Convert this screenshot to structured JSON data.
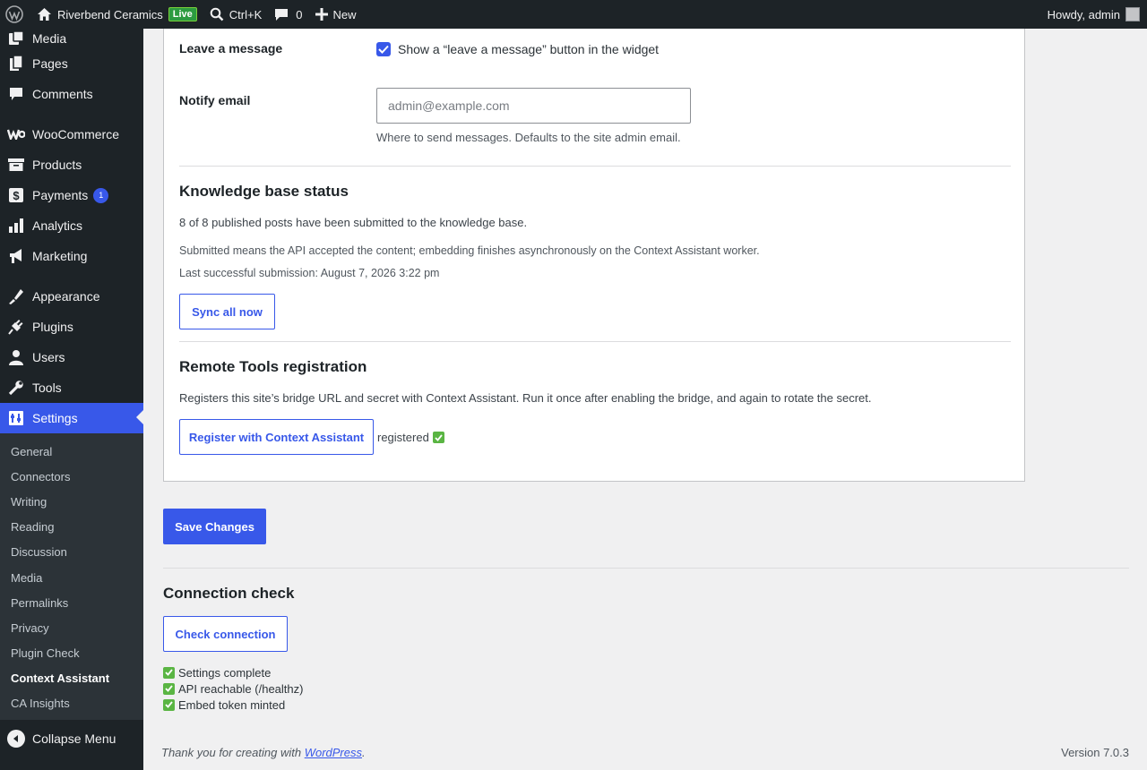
{
  "adminbar": {
    "site_name": "Riverbend Ceramics",
    "live_badge": "Live",
    "search_shortcut": "Ctrl+K",
    "comments_count": "0",
    "new_label": "New",
    "greeting": "Howdy, admin"
  },
  "sidebar": {
    "items": [
      {
        "label": "Media",
        "icon": "media-icon"
      },
      {
        "label": "Pages",
        "icon": "pages-icon"
      },
      {
        "label": "Comments",
        "icon": "comments-icon"
      },
      {
        "label": "WooCommerce",
        "icon": "woocommerce-icon"
      },
      {
        "label": "Products",
        "icon": "products-icon"
      },
      {
        "label": "Payments",
        "icon": "payments-icon",
        "badge": "1"
      },
      {
        "label": "Analytics",
        "icon": "analytics-icon"
      },
      {
        "label": "Marketing",
        "icon": "marketing-icon"
      },
      {
        "label": "Appearance",
        "icon": "appearance-icon"
      },
      {
        "label": "Plugins",
        "icon": "plugins-icon"
      },
      {
        "label": "Users",
        "icon": "users-icon"
      },
      {
        "label": "Tools",
        "icon": "tools-icon"
      },
      {
        "label": "Settings",
        "icon": "settings-icon"
      }
    ],
    "submenu": [
      "General",
      "Connectors",
      "Writing",
      "Reading",
      "Discussion",
      "Media",
      "Permalinks",
      "Privacy",
      "Plugin Check",
      "Context Assistant",
      "CA Insights"
    ],
    "collapse_label": "Collapse Menu"
  },
  "form": {
    "leave_message_label": "Leave a message",
    "leave_message_checkbox": "Show a “leave a message” button in the widget",
    "leave_message_checked": true,
    "notify_email_label": "Notify email",
    "notify_email_placeholder": "admin@example.com",
    "notify_email_value": "",
    "notify_email_help": "Where to send messages. Defaults to the site admin email."
  },
  "kb": {
    "title": "Knowledge base status",
    "summary": "8 of 8 published posts have been submitted to the knowledge base.",
    "note": "Submitted means the API accepted the content; embedding finishes asynchronously on the Context Assistant worker.",
    "last_submission": "Last successful submission: August 7, 2026 3:22 pm",
    "sync_button": "Sync all now"
  },
  "remote": {
    "title": "Remote Tools registration",
    "description": "Registers this site’s bridge URL and secret with Context Assistant. Run it once after enabling the bridge, and again to rotate the secret.",
    "register_button": "Register with Context Assistant",
    "status": "registered"
  },
  "save_button": "Save Changes",
  "connection": {
    "title": "Connection check",
    "button": "Check connection",
    "results": [
      "Settings complete",
      "API reachable (/healthz)",
      "Embed token minted"
    ]
  },
  "footer": {
    "thanks_prefix": "Thank you for creating with ",
    "thanks_link": "WordPress",
    "thanks_suffix": ".",
    "version": "Version 7.0.3"
  },
  "colors": {
    "accent": "#3858e9",
    "adminbar_bg": "#1d2327",
    "check_green": "#5ab543"
  }
}
